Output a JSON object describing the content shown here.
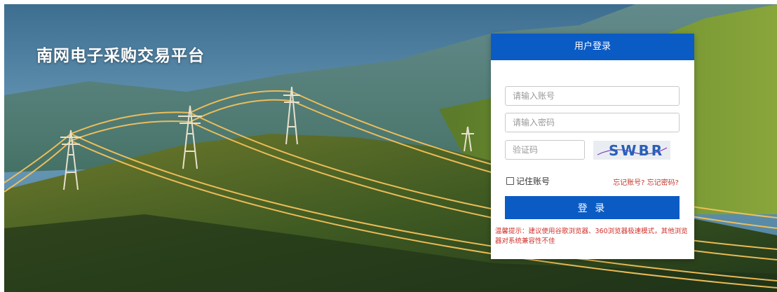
{
  "site": {
    "title": "南网电子采购交易平台"
  },
  "login": {
    "header": "用户登录",
    "account_placeholder": "请输入账号",
    "password_placeholder": "请输入密码",
    "captcha_placeholder": "验证码",
    "captcha_text": "SWBR",
    "remember_label": "记住账号",
    "forgot_account": "忘记账号?",
    "forgot_password": "忘记密码?",
    "submit_label": "登 录",
    "tip": "温馨提示：建议使用谷歌浏览器、360浏览器极速模式，其他浏览器对系统兼容性不佳"
  },
  "colors": {
    "accent": "#0b5bc4",
    "warning": "#d0302a"
  }
}
